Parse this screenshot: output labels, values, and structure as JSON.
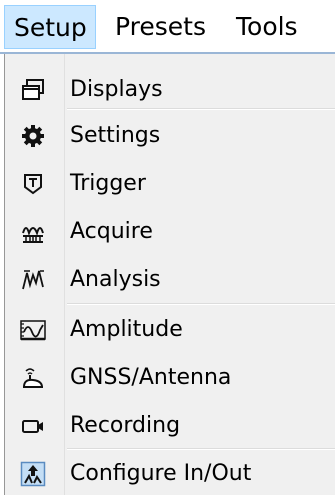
{
  "menubar": {
    "items": [
      {
        "label": "Setup"
      },
      {
        "label": "Presets"
      },
      {
        "label": "Tools"
      }
    ]
  },
  "menu": {
    "items": [
      {
        "label": "Displays",
        "icon": "displays-icon"
      },
      {
        "label": "Settings",
        "icon": "gear-icon"
      },
      {
        "label": "Trigger",
        "icon": "trigger-icon"
      },
      {
        "label": "Acquire",
        "icon": "acquire-icon"
      },
      {
        "label": "Analysis",
        "icon": "analysis-icon"
      },
      {
        "label": "Amplitude",
        "icon": "amplitude-icon"
      },
      {
        "label": "GNSS/Antenna",
        "icon": "gnss-antenna-icon"
      },
      {
        "label": "Recording",
        "icon": "recording-icon"
      },
      {
        "label": "Configure In/Out",
        "icon": "configure-io-icon"
      }
    ]
  }
}
